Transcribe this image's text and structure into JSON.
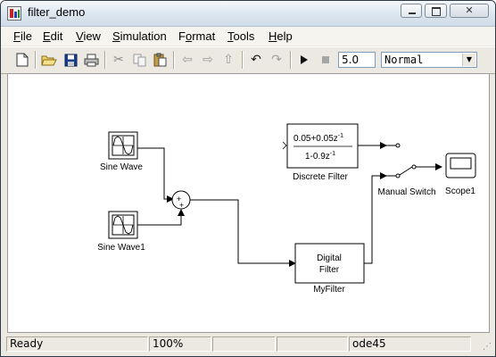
{
  "window": {
    "title": "filter_demo"
  },
  "menu": {
    "file": {
      "u": "F",
      "rest": "ile"
    },
    "edit": {
      "u": "E",
      "rest": "dit"
    },
    "view": {
      "u": "V",
      "rest": "iew"
    },
    "simulation": {
      "u": "S",
      "rest": "imulation"
    },
    "format": {
      "pre": "F",
      "u": "o",
      "rest": "rmat"
    },
    "tools": {
      "u": "T",
      "rest": "ools"
    },
    "help": {
      "u": "H",
      "rest": "elp"
    }
  },
  "toolbar": {
    "stop_time": "5.0",
    "sim_mode": "Normal",
    "icons": [
      "new-file-icon",
      "open-folder-icon",
      "save-icon",
      "print-icon",
      "cut-icon",
      "copy-icon",
      "paste-icon",
      "back-icon",
      "forward-icon",
      "up-icon",
      "undo-icon",
      "redo-icon",
      "start-simulation-icon",
      "stop-simulation-icon",
      "dropdown-arrow-icon"
    ]
  },
  "diagram": {
    "blocks": {
      "sine_wave": {
        "label": "Sine Wave"
      },
      "sine_wave1": {
        "label": "Sine Wave1"
      },
      "sum": {
        "signs": [
          "+",
          "+"
        ]
      },
      "discrete_filter": {
        "numerator": "0.05+0.05z",
        "numerator_exp": "-1",
        "denominator": "1-0.9z",
        "denominator_exp": "-1",
        "label": "Discrete Filter"
      },
      "myfilter": {
        "line1": "Digital",
        "line2": "Filter",
        "label": "MyFilter"
      },
      "manual_switch": {
        "label": "Manual Switch"
      },
      "scope": {
        "label": "Scope1"
      }
    }
  },
  "status": {
    "state": "Ready",
    "zoom": "100%",
    "solver": "ode45"
  }
}
